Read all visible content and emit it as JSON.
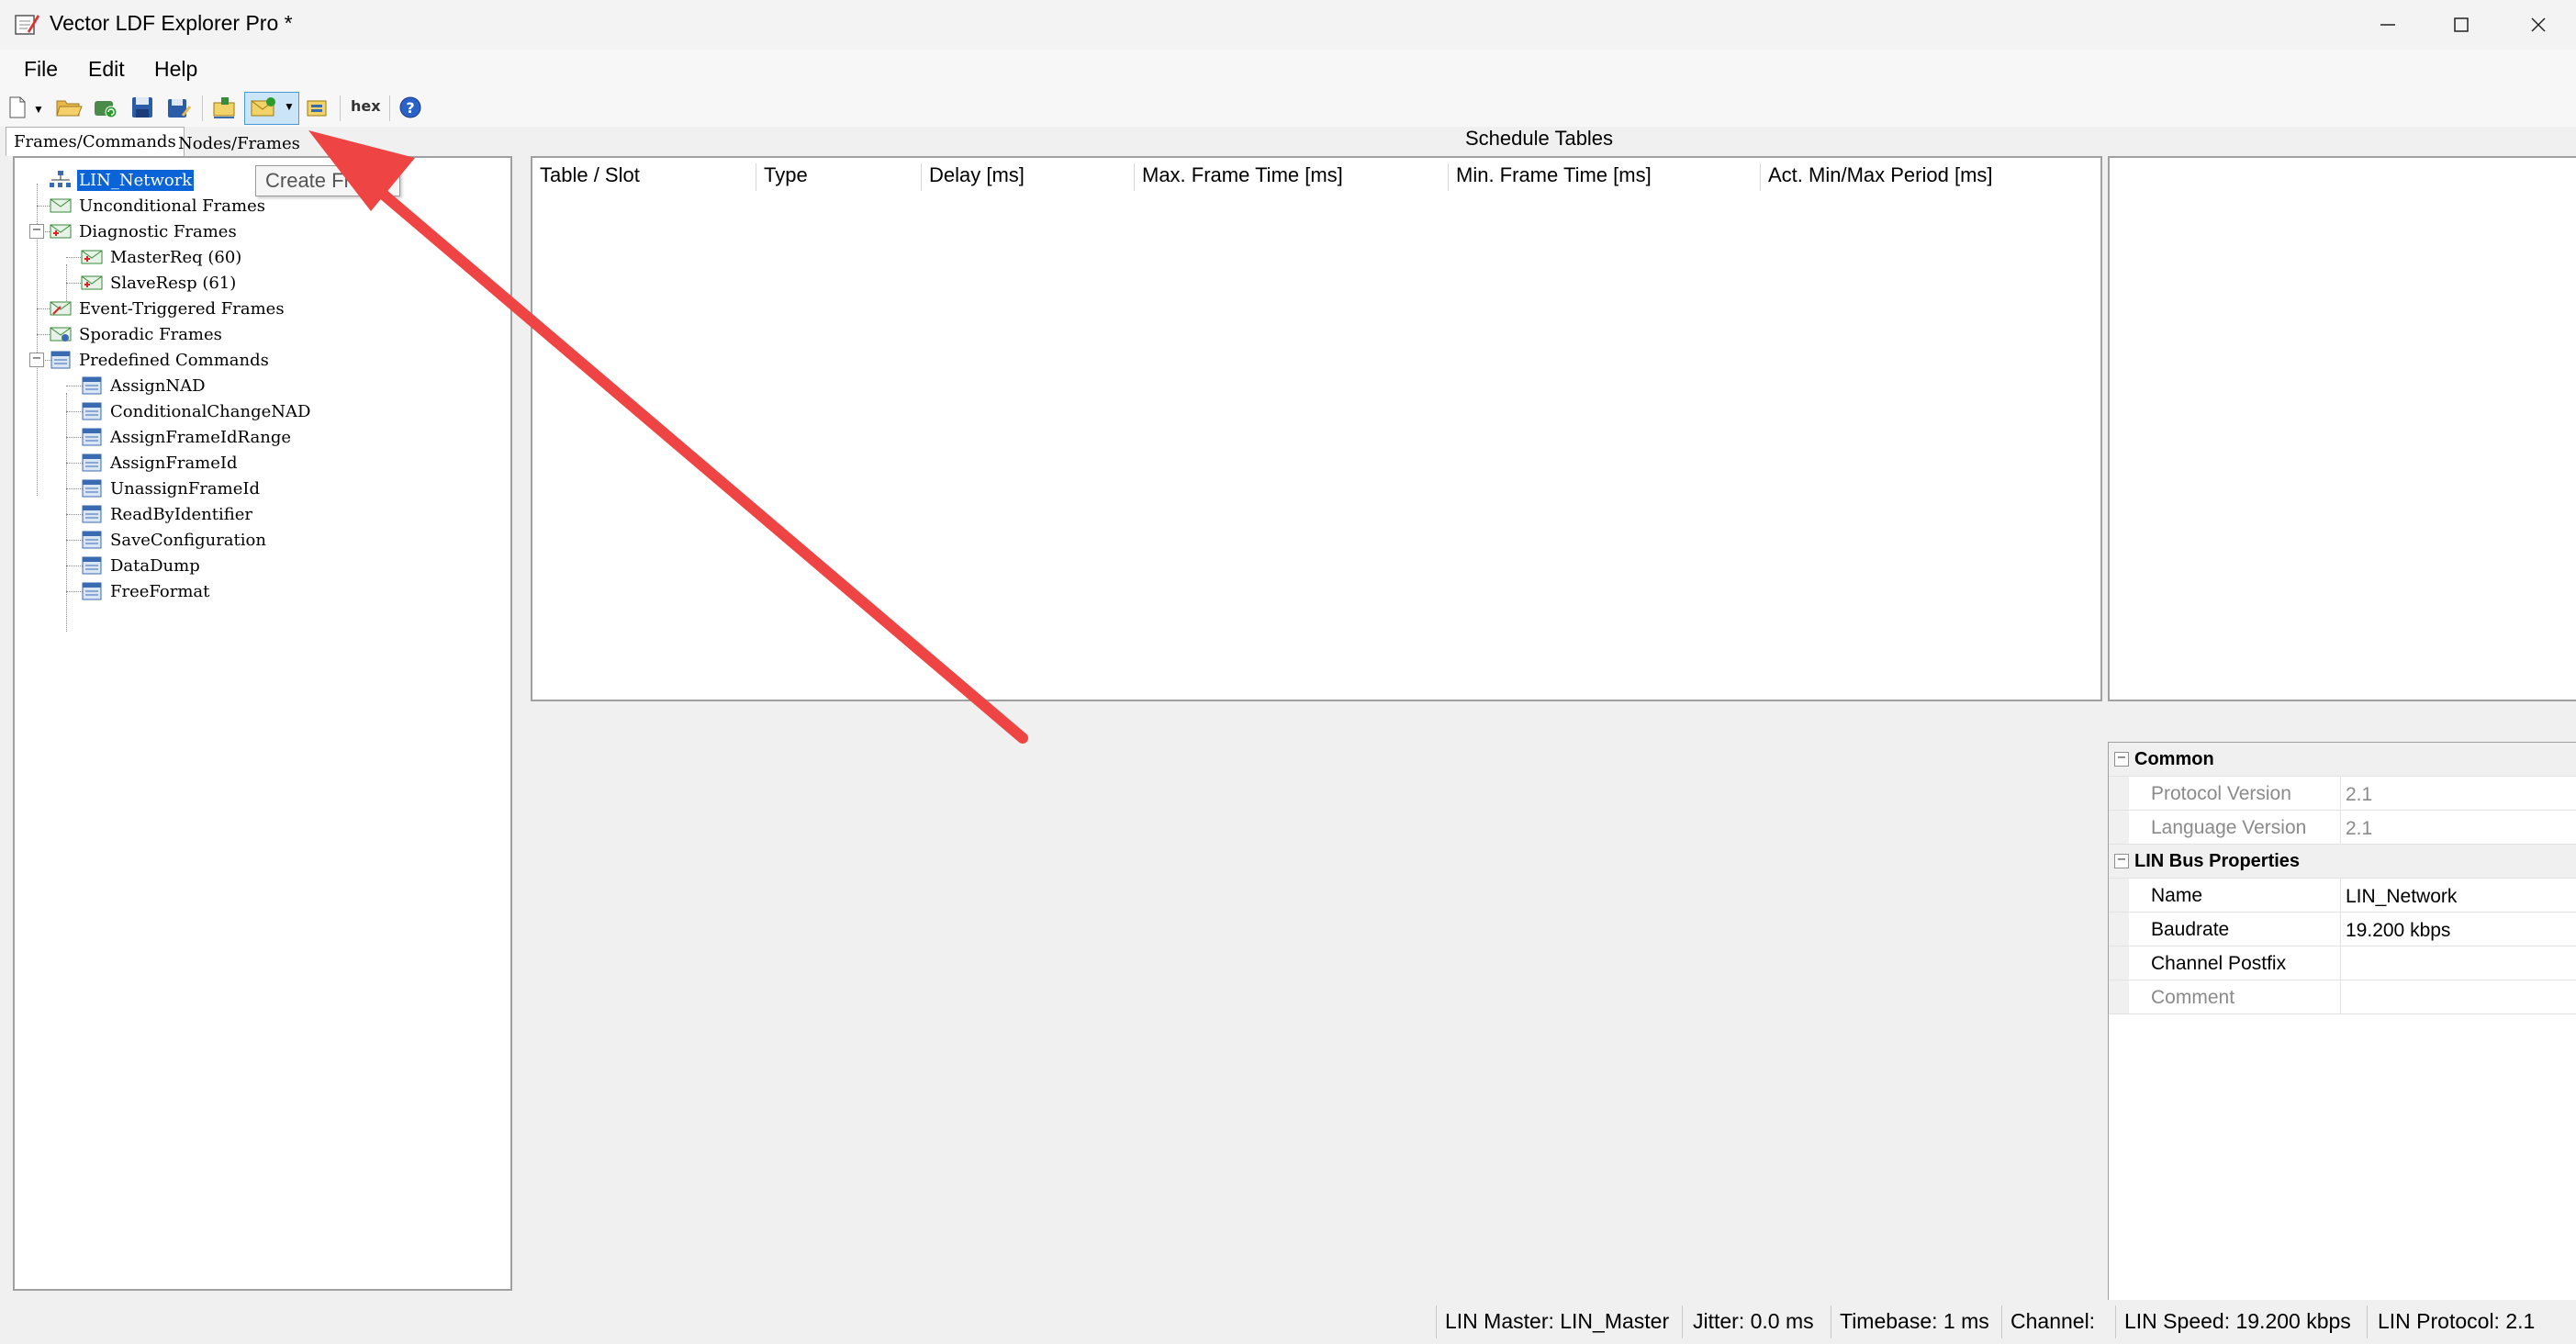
{
  "window": {
    "title": "Vector LDF Explorer Pro *"
  },
  "menu": {
    "items": [
      "File",
      "Edit",
      "Help"
    ]
  },
  "toolbar": {
    "hex_label": "hex"
  },
  "tabs": [
    {
      "label": "Frames/Commands"
    },
    {
      "label": "Nodes/Frames"
    }
  ],
  "tooltip": {
    "text": "Create Frame"
  },
  "tree": {
    "items": [
      {
        "label": "LIN_Network"
      },
      {
        "label": "Unconditional Frames"
      },
      {
        "label": "Diagnostic Frames"
      },
      {
        "label": "MasterReq (60)"
      },
      {
        "label": "SlaveResp (61)"
      },
      {
        "label": "Event-Triggered Frames"
      },
      {
        "label": "Sporadic Frames"
      },
      {
        "label": "Predefined Commands"
      },
      {
        "label": "AssignNAD"
      },
      {
        "label": "ConditionalChangeNAD"
      },
      {
        "label": "AssignFrameIdRange"
      },
      {
        "label": "AssignFrameId"
      },
      {
        "label": "UnassignFrameId"
      },
      {
        "label": "ReadByIdentifier"
      },
      {
        "label": "SaveConfiguration"
      },
      {
        "label": "DataDump"
      },
      {
        "label": "FreeFormat"
      }
    ]
  },
  "schedule": {
    "title": "Schedule Tables",
    "columns": [
      "Table / Slot",
      "Type",
      "Delay [ms]",
      "Max. Frame Time [ms]",
      "Min. Frame Time [ms]",
      "Act. Min/Max Period [ms]"
    ]
  },
  "properties": {
    "categories": [
      {
        "name": "Common",
        "rows": [
          {
            "name": "Protocol Version",
            "value": "2.1"
          },
          {
            "name": "Language Version",
            "value": "2.1"
          }
        ]
      },
      {
        "name": "LIN Bus Properties",
        "rows": [
          {
            "name": "Name",
            "value": "LIN_Network"
          },
          {
            "name": "Baudrate",
            "value": "19.200 kbps"
          },
          {
            "name": "Channel Postfix",
            "value": ""
          },
          {
            "name": "Comment",
            "value": ""
          }
        ]
      }
    ]
  },
  "statusbar": {
    "lin_master": "LIN Master: LIN_Master",
    "jitter": "Jitter: 0.0 ms",
    "timebase": "Timebase: 1 ms",
    "channel": "Channel:",
    "lin_speed": "LIN Speed: 19.200 kbps",
    "lin_protocol": "LIN Protocol: 2.1"
  },
  "colors": {
    "selection": "#0a64d8",
    "annotation_arrow": "#ef4444"
  }
}
